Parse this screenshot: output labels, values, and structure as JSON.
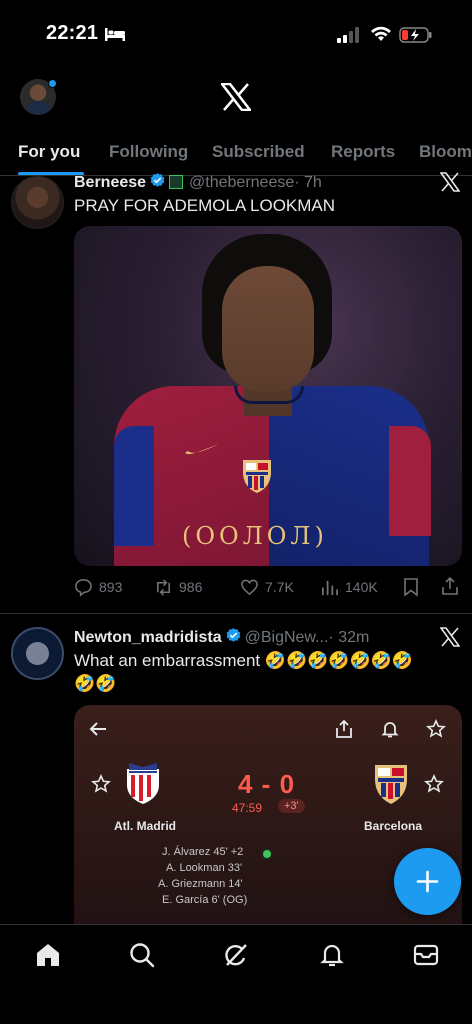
{
  "status_bar": {
    "time": "22:21"
  },
  "tabs": [
    {
      "label": "For you",
      "active": true
    },
    {
      "label": "Following"
    },
    {
      "label": "Subscribed"
    },
    {
      "label": "Reports"
    },
    {
      "label": "Bloom"
    }
  ],
  "tweets": [
    {
      "name": "Berneese",
      "handle": "@theberneese",
      "time": "· 7h",
      "text": "PRAY FOR ADEMOLA LOOKMAN",
      "image_sponsor": "(ООЛОЛ)",
      "stats": {
        "replies": "893",
        "reposts": "986",
        "likes": "7.7K",
        "views": "140K"
      }
    },
    {
      "name": "Newton_madridista",
      "handle": "@BigNew...",
      "time": "· 32m",
      "text_line1": "What an embarrassment 🤣🤣🤣🤣🤣🤣🤣",
      "text_line2": "🤣🤣",
      "card": {
        "home_team": "Atl. Madrid",
        "away_team": "Barcelona",
        "score": "4 - 0",
        "clock": "47:59",
        "added_time": "+3'",
        "scorers": [
          "J. Álvarez 45' +2",
          "A. Lookman 33'",
          "A. Griezmann 14'",
          "E. García 6' (OG)"
        ]
      }
    }
  ],
  "colors": {
    "accent": "#1d9bf0",
    "score": "#ff5a4e",
    "muted": "#71767b"
  },
  "icons": [
    "home-icon",
    "search-icon",
    "grok-icon",
    "notifications-icon",
    "messages-icon",
    "compose-icon"
  ]
}
